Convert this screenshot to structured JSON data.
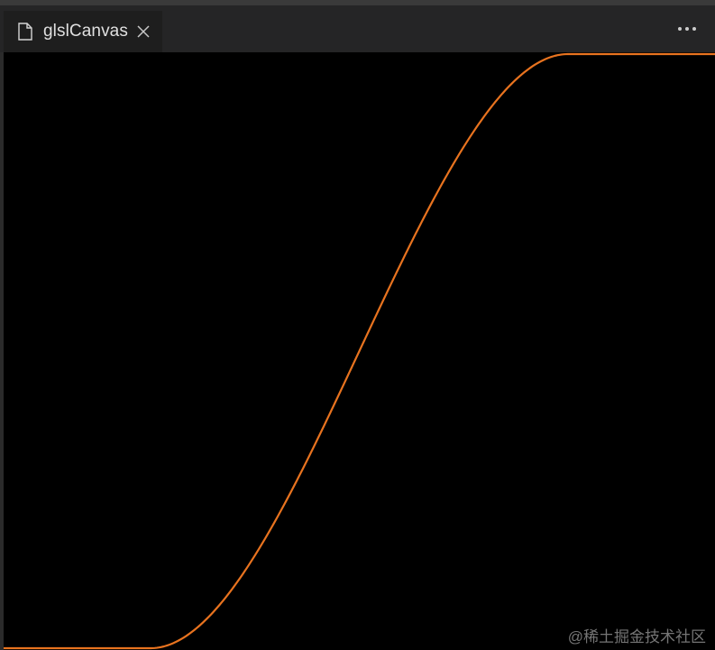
{
  "tab": {
    "label": "glslCanvas"
  },
  "icons": {
    "file": "file-icon",
    "close": "close-icon",
    "more": "more-actions-icon"
  },
  "canvas": {
    "background": "#000000",
    "curve_color": "#e8731f",
    "function": "smoothstep"
  },
  "watermark": {
    "text": "@稀土掘金技术社区"
  },
  "colors": {
    "tabbar": "#252526",
    "active_tab": "#1e1e1e",
    "tab_text": "#e0e0e0"
  }
}
